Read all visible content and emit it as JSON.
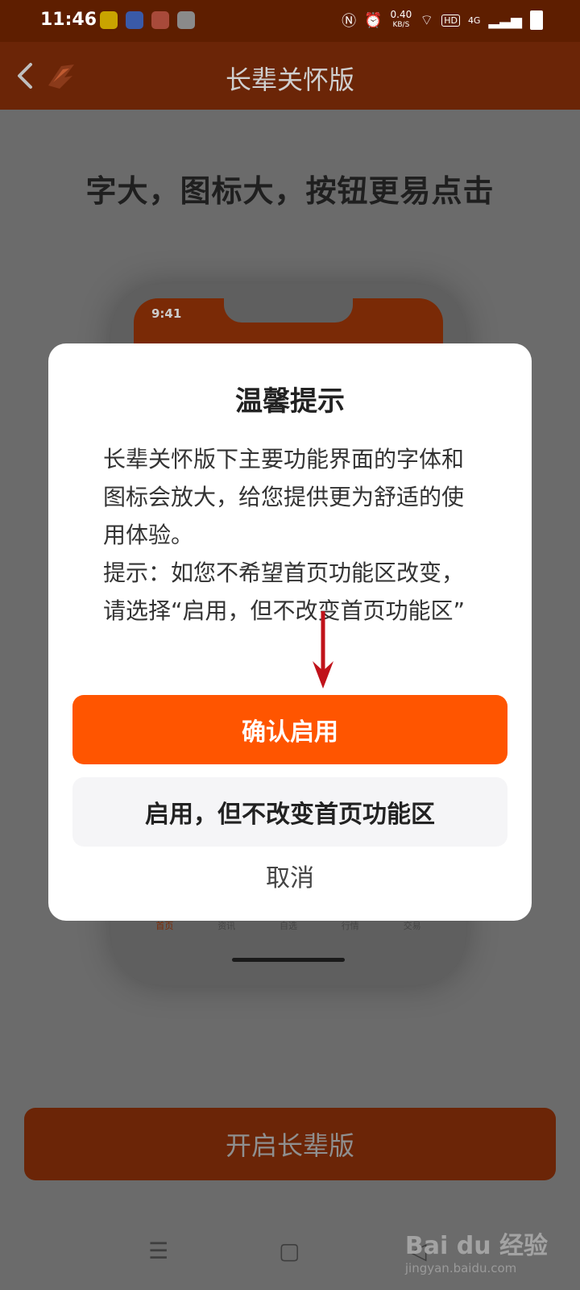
{
  "status_bar": {
    "time": "11:46",
    "net_speed_value": "0.40",
    "net_speed_unit": "KB/S",
    "hd_label": "HD",
    "network_label": "4G"
  },
  "app_bar": {
    "title": "长辈关怀版"
  },
  "page": {
    "headline": "字大，图标大，按钮更易点击",
    "cta_label": "开启长辈版"
  },
  "preview_phone": {
    "time": "9:41",
    "tabs": [
      "首页",
      "资讯",
      "自选",
      "行情",
      "交易"
    ]
  },
  "dialog": {
    "title": "温馨提示",
    "body_line1": "长辈关怀版下主要功能界面的字体和图标会放大，给您提供更为舒适的使用体验。",
    "body_line2": "提示：如您不希望首页功能区改变，请选择“启用，但不改变首页功能区”",
    "confirm_label": "确认启用",
    "alt_label": "启用，但不改变首页功能区",
    "cancel_label": "取消"
  },
  "watermark": {
    "brand": "Bai du 经验",
    "url": "jingyan.baidu.com"
  },
  "colors": {
    "accent": "#ff5500",
    "appbar_dark": "#6b2507"
  }
}
